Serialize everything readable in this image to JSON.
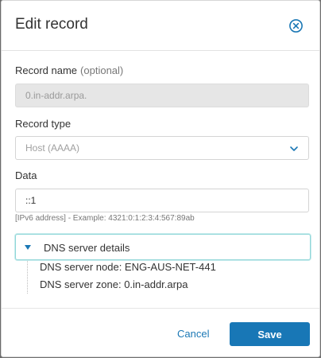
{
  "dialog": {
    "title": "Edit record",
    "close_icon": "close-circle-icon"
  },
  "fields": {
    "record_name": {
      "label": "Record name",
      "optional": "(optional)",
      "value": "0.in-addr.arpa."
    },
    "record_type": {
      "label": "Record type",
      "selected": "Host (AAAA)",
      "icon": "chevron-down-icon"
    },
    "data": {
      "label": "Data",
      "value": "::1",
      "hint": "[IPv6 address] - Example: 4321:0:1:2:3:4:567:89ab"
    }
  },
  "details": {
    "title": "DNS server details",
    "caret_icon": "caret-down-icon",
    "node": "DNS server node: ENG-AUS-NET-441",
    "zone": "DNS server zone: 0.in-addr.arpa"
  },
  "footer": {
    "cancel_label": "Cancel",
    "save_label": "Save"
  },
  "colors": {
    "accent": "#1877b6",
    "link": "#1b78b5",
    "focus_border": "#8fd6d8"
  }
}
